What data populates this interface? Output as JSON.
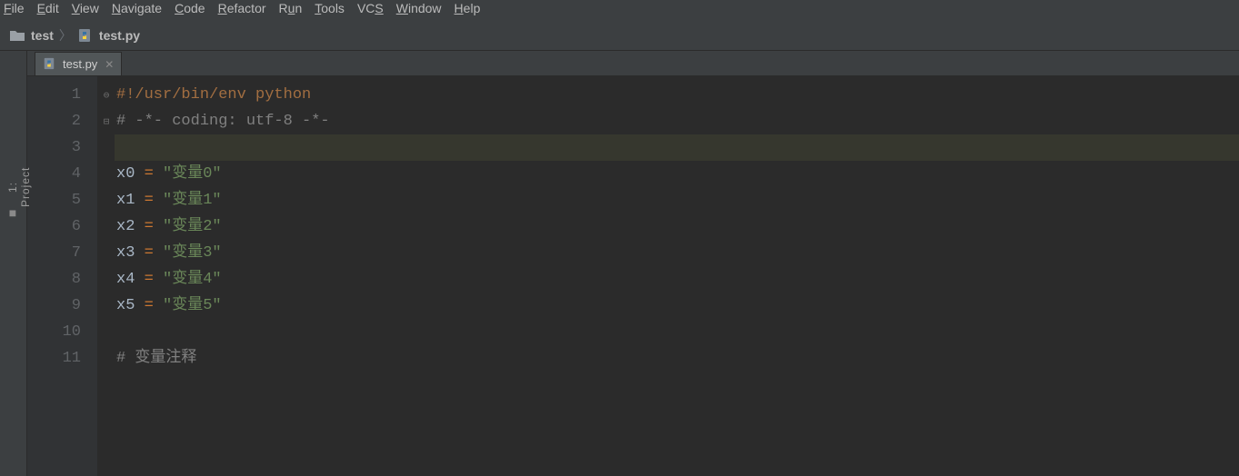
{
  "menu": {
    "file": "File",
    "edit": "Edit",
    "view": "View",
    "navigate": "Navigate",
    "code": "Code",
    "refactor": "Refactor",
    "run": "Run",
    "tools": "Tools",
    "vcs": "VCS",
    "window": "Window",
    "help": "Help"
  },
  "breadcrumb": {
    "folder": "test",
    "file": "test.py"
  },
  "sidebar": {
    "project_label": "1: Project"
  },
  "tabs": [
    {
      "label": "test.py"
    }
  ],
  "code_lines": [
    {
      "n": "1",
      "type": "shebang",
      "text": "#!/usr/bin/env python"
    },
    {
      "n": "2",
      "type": "comment",
      "text": "# -*- coding: utf-8 -*-"
    },
    {
      "n": "3",
      "type": "blank"
    },
    {
      "n": "4",
      "type": "assign",
      "var": "x0",
      "str": "\"变量0\""
    },
    {
      "n": "5",
      "type": "assign",
      "var": "x1",
      "str": "\"变量1\""
    },
    {
      "n": "6",
      "type": "assign",
      "var": "x2",
      "str": "\"变量2\""
    },
    {
      "n": "7",
      "type": "assign",
      "var": "x3",
      "str": "\"变量3\""
    },
    {
      "n": "8",
      "type": "assign",
      "var": "x4",
      "str": "\"变量4\""
    },
    {
      "n": "9",
      "type": "assign",
      "var": "x5",
      "str": "\"变量5\""
    },
    {
      "n": "10",
      "type": "blank"
    },
    {
      "n": "11",
      "type": "comment",
      "text": "# 变量注释"
    }
  ],
  "highlight_line_index": 2
}
